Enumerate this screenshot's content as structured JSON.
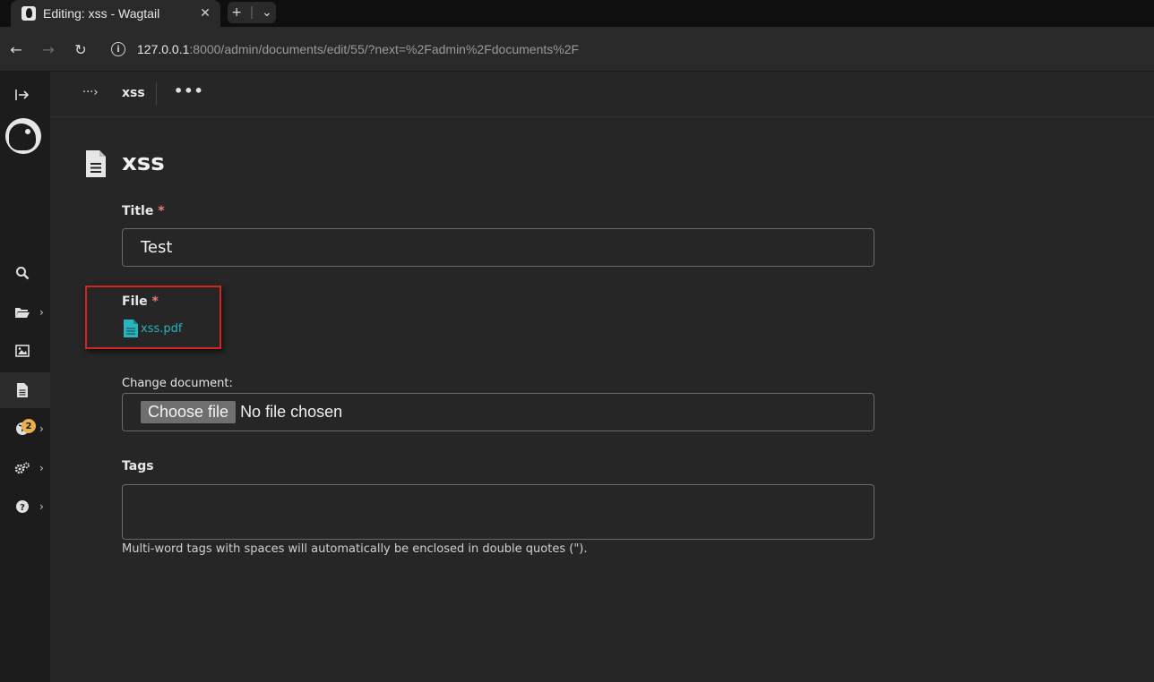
{
  "browser": {
    "tab_title": "Editing: xss - Wagtail",
    "url_host": "127.0.0.1",
    "url_rest": ":8000/admin/documents/edit/55/?next=%2Fadmin%2Fdocuments%2F"
  },
  "sidebar": {
    "items": [
      {
        "name": "expand-sidebar",
        "icon": "expand-icon"
      },
      {
        "name": "search",
        "icon": "search-icon"
      },
      {
        "name": "pages",
        "icon": "folder-open-icon",
        "has_children": true
      },
      {
        "name": "images",
        "icon": "image-icon"
      },
      {
        "name": "documents",
        "icon": "document-icon",
        "active": true
      },
      {
        "name": "snippets",
        "icon": "globe-icon",
        "has_children": true
      },
      {
        "name": "settings",
        "icon": "cogs-icon",
        "has_children": true
      },
      {
        "name": "help",
        "icon": "help-icon",
        "has_children": true
      }
    ],
    "help_badge": "2"
  },
  "header": {
    "breadcrumb_title": "xss"
  },
  "page": {
    "title": "xss",
    "fields": {
      "title": {
        "label": "Title",
        "required_mark": "*",
        "value": "Test"
      },
      "file": {
        "label": "File",
        "required_mark": "*",
        "filename": "xss.pdf"
      },
      "change_document": {
        "label": "Change document:",
        "button": "Choose file",
        "status": "No file chosen"
      },
      "tags": {
        "label": "Tags",
        "value": "",
        "help_text": "Multi-word tags with spaces will automatically be enclosed in double quotes (\")."
      }
    }
  },
  "colors": {
    "accent_link": "#2ab2bd",
    "required": "#f17a7a",
    "highlight_border": "#d42424"
  }
}
